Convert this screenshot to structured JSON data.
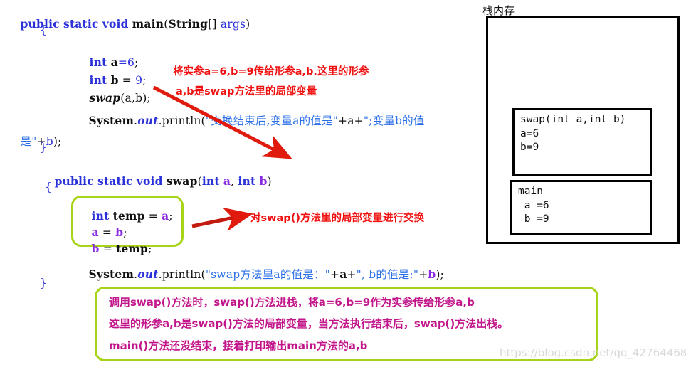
{
  "code": {
    "lines": [
      {
        "id": "l1",
        "text": "public static void main(String[] args)"
      },
      {
        "id": "l2",
        "text": "{"
      },
      {
        "id": "l3",
        "text": "int a=6;"
      },
      {
        "id": "l4",
        "text": "int b = 9;"
      },
      {
        "id": "l5",
        "text": "swap(a,b);"
      },
      {
        "id": "l6",
        "text": "System.out.println(\"交换结束后,变量a的值是\"+a+\";变量b的值"
      },
      {
        "id": "l7",
        "text": "是\"+b);"
      },
      {
        "id": "l8",
        "text": "}"
      },
      {
        "id": "l9",
        "text": "public static void swap(int a,int b)"
      },
      {
        "id": "l10",
        "text": "{"
      },
      {
        "id": "l11",
        "text": "int temp = a;"
      },
      {
        "id": "l12",
        "text": "a = b;"
      },
      {
        "id": "l13",
        "text": "b = temp;"
      },
      {
        "id": "l14",
        "text": "System.out.println(\"swap方法里a的值是：\"+a+\", b的值是:\"+b);"
      },
      {
        "id": "l15",
        "text": "}"
      }
    ]
  },
  "annotations": {
    "red_1": "将实参a=6,b=9传给形参a,b.这里的形参",
    "red_2": "a,b是swap方法里的局部变量",
    "red_3": "对swap()方法里的局部变量进行交换"
  },
  "explain_box": {
    "line1": "调用swap()方法时，swap()方法进栈，将a=6,b=9作为实参传给形参a,b",
    "line2": "这里的形参a,b是swap()方法的局部变量，当方法执行结束后，swap()方法出栈。",
    "line3": "main()方法还没结束，接着打印输出main方法的a,b"
  },
  "stack_panel": {
    "title": "栈内存",
    "frames": [
      {
        "name": "swap-frame",
        "line1": "swap(int a,int b)",
        "line2": "a=6",
        "line3": "b=9"
      },
      {
        "name": "main-frame",
        "line1": "main",
        "line2": " a =6",
        "line3": " b =9"
      }
    ]
  },
  "watermark": {
    "text": "https://blog.csdn.net/qq_42764468"
  },
  "colors": {
    "keyword_blue": "#2b31d8",
    "string_blue": "#2b6fe8",
    "variable_purple": "#8a2be2",
    "annotation_red": "#f01010",
    "box_green": "#a8d418",
    "explain_magenta": "#c2158a",
    "stack_border": "#000000",
    "watermark_gray": "#d8d8d8"
  }
}
